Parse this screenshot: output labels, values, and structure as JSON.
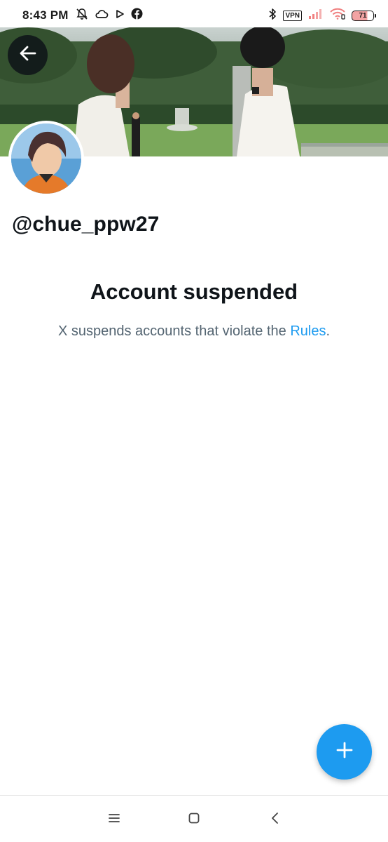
{
  "status_bar": {
    "time": "8:43 PM",
    "vpn_label": "VPN",
    "battery_level": "71",
    "left_icons": [
      "mute-bell-icon",
      "cloud-icon",
      "play-icon",
      "facebook-icon"
    ],
    "right_icons": [
      "bluetooth-icon",
      "vpn-icon",
      "signal-icon",
      "wifi-icon",
      "battery-icon"
    ]
  },
  "header": {
    "back_icon": "arrow-left-icon"
  },
  "profile": {
    "handle": "@chue_ppw27"
  },
  "suspension": {
    "title": "Account suspended",
    "message_prefix": "X suspends accounts that violate the ",
    "rules_link": "Rules",
    "message_suffix": "."
  },
  "fab": {
    "icon": "plus-icon"
  },
  "nav_bar": {
    "icons": [
      "menu-icon",
      "home-square-icon",
      "back-chevron-icon"
    ]
  },
  "colors": {
    "accent": "#1d9bf0",
    "text_primary": "#0f1419",
    "text_secondary": "#536471"
  }
}
